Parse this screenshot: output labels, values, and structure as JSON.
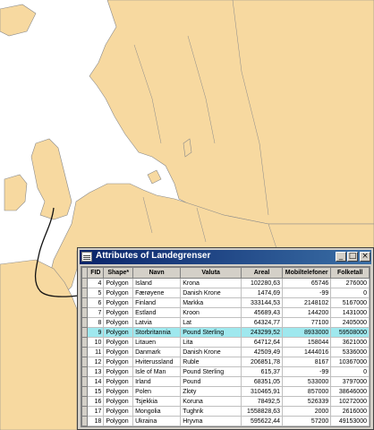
{
  "window": {
    "title": "Attributes of Landegrenser",
    "buttons": {
      "minimize": "_",
      "maximize": "□",
      "close": "×"
    }
  },
  "table": {
    "columns": [
      "FID",
      "Shape*",
      "Navn",
      "Valuta",
      "Areal",
      "Mobiltelefoner",
      "Folketall"
    ],
    "rows": [
      [
        "4",
        "Polygon",
        "Island",
        "Krona",
        "102280,63",
        "65746",
        "276000"
      ],
      [
        "5",
        "Polygon",
        "Færøyene",
        "Danish Krone",
        "1474,69",
        "-99",
        "0"
      ],
      [
        "6",
        "Polygon",
        "Finland",
        "Markka",
        "333144,53",
        "2148102",
        "5167000"
      ],
      [
        "7",
        "Polygon",
        "Estland",
        "Kroon",
        "45689,43",
        "144200",
        "1431000"
      ],
      [
        "8",
        "Polygon",
        "Latvia",
        "Lat",
        "64324,77",
        "77100",
        "2405000"
      ],
      [
        "9",
        "Polygon",
        "Storbritannia",
        "Pound Sterling",
        "243299,52",
        "8933000",
        "59508000"
      ],
      [
        "10",
        "Polygon",
        "Litauen",
        "Lita",
        "64712,64",
        "158044",
        "3621000"
      ],
      [
        "11",
        "Polygon",
        "Danmark",
        "Danish Krone",
        "42509,49",
        "1444016",
        "5336000"
      ],
      [
        "12",
        "Polygon",
        "Hviterussland",
        "Ruble",
        "206851,78",
        "8167",
        "10367000"
      ],
      [
        "13",
        "Polygon",
        "Isle of Man",
        "Pound Sterling",
        "615,37",
        "-99",
        "0"
      ],
      [
        "14",
        "Polygon",
        "Irland",
        "Pound",
        "68351,05",
        "533000",
        "3797000"
      ],
      [
        "15",
        "Polygon",
        "Polen",
        "Zloty",
        "310465,91",
        "857000",
        "38646000"
      ],
      [
        "16",
        "Polygon",
        "Tsjekkia",
        "Koruna",
        "78492,5",
        "526339",
        "10272000"
      ],
      [
        "17",
        "Polygon",
        "Mongolia",
        "Tughrik",
        "1558828,63",
        "2000",
        "2616000"
      ],
      [
        "18",
        "Polygon",
        "Ukraina",
        "Hryvna",
        "595622,44",
        "57200",
        "49153000"
      ],
      [
        "19",
        "Polygon",
        "Luxembourg",
        "Luxembourg Franc",
        "2572,07",
        "67208",
        "437000"
      ],
      [
        "20",
        "Polygon",
        "Tyskland",
        "Mark",
        "355926",
        "8170000",
        "82797000"
      ]
    ],
    "highlighted_fid": "9"
  },
  "colors": {
    "land": "#f7d9a0",
    "sea": "#ffffff",
    "border": "#8a8a8a",
    "selection": "#9fe8ee",
    "titlebar": "#0a246a"
  }
}
